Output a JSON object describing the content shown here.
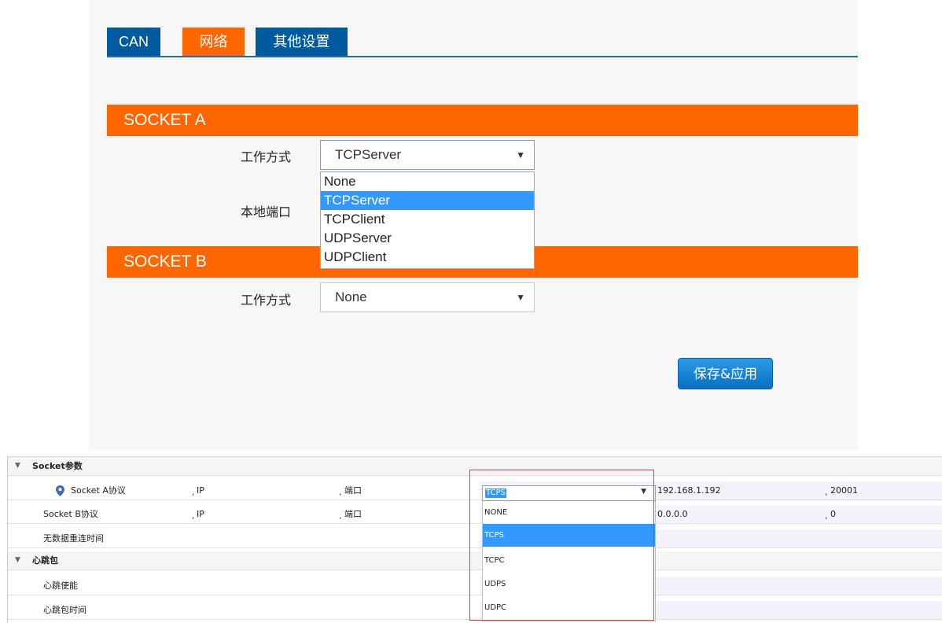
{
  "tabs": [
    {
      "label": "CAN"
    },
    {
      "label": "网络"
    },
    {
      "label": "其他设置"
    }
  ],
  "socket_a": {
    "title": "SOCKET A",
    "mode_label": "工作方式",
    "mode_value": "TCPServer",
    "port_label": "本地端口",
    "options": [
      "None",
      "TCPServer",
      "TCPClient",
      "UDPServer",
      "UDPClient"
    ],
    "selected_option": "TCPServer"
  },
  "socket_b": {
    "title": "SOCKET B",
    "mode_label": "工作方式",
    "mode_value": "None"
  },
  "save_button": "保存&应用",
  "grid": {
    "categories": [
      {
        "name": "Socket参数"
      },
      {
        "name": "心跳包"
      }
    ],
    "rows": {
      "socket_a": {
        "name": "Socket A协议",
        "ip_label": "IP",
        "port_label": "端口",
        "protocol": "TCPS",
        "ip": "192.168.1.192",
        "port": "20001"
      },
      "socket_b": {
        "name": "Socket B协议",
        "ip_label": "IP",
        "port_label": "端口",
        "ip": "0.0.0.0",
        "port": "0"
      },
      "reconnect": {
        "name": "无数据重连时间"
      },
      "hb_enable": {
        "name": "心跳使能"
      },
      "hb_time": {
        "name": "心跳包时间"
      }
    },
    "protocol_options": [
      "NONE",
      "TCPS",
      "TCPC",
      "UDPS",
      "UDPC"
    ],
    "protocol_selected": "TCPS"
  },
  "icons": {
    "dropdown_arrow": "▼",
    "collapse_triangle": "▼",
    "location_pin": "location-pin-icon"
  },
  "colors": {
    "tab_blue": "#005a9e",
    "accent_orange": "#ff6600",
    "selection_blue": "#3399ff",
    "highlight_red": "#e23c3c"
  }
}
